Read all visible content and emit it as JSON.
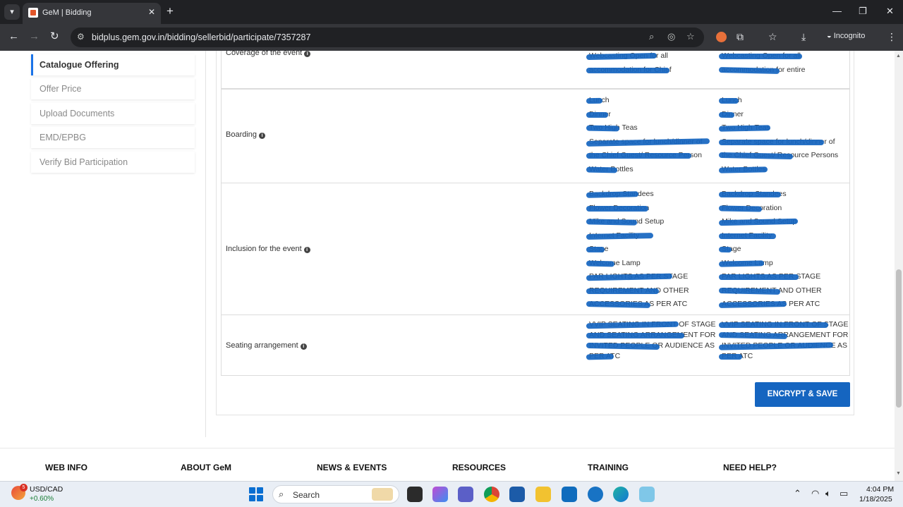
{
  "browser": {
    "tab_title": "GeM | Bidding",
    "url": "bidplus.gem.gov.in/bidding/sellerbid/participate/7357287",
    "profile_label": "Incognito"
  },
  "sidebar": {
    "items": [
      {
        "label": "Catalogue Offering",
        "active": true
      },
      {
        "label": "Offer Price",
        "active": false
      },
      {
        "label": "Upload Documents",
        "active": false
      },
      {
        "label": "EMD/EPBG",
        "active": false
      },
      {
        "label": "Verify Bid Participation",
        "active": false
      }
    ]
  },
  "table": {
    "rows": [
      {
        "label": "Coverage of the event",
        "col1": [
          "Webcasting Open for all",
          "accommodation for Chief"
        ],
        "col2": [
          "Webcasting Open for all",
          "accommodation for entire"
        ]
      },
      {
        "label": "Boarding",
        "col1": [
          "Lunch",
          "Dinner",
          "Two High Teas",
          "Separate space for lunch/dinner of",
          "the Chief Guest/ Resource Person",
          "Water Bottles"
        ],
        "col2": [
          "Lunch",
          "Dinner",
          "Two High Teas",
          "Separate space for lunch/dinner of",
          "the Chief Guest/ Resource Persons",
          "Water Bottles"
        ]
      },
      {
        "label": "Inclusion for the event",
        "col1": [
          "Backdrop Standees",
          "Flower Decoration",
          "Mike and Sound Setup",
          "Internet Facility",
          "Stage",
          "Welcome Lamp",
          "PAR LIGHTS AS PER STAGE",
          "REQUIREMENT AND OTHER",
          "ACCESSORIES AS PER ATC"
        ],
        "col2": [
          "Backdrop Standees",
          "Flower Decoration",
          "Mike and Sound Setup",
          "Internet Facility",
          "Stage",
          "Welcome Lamp",
          "PAR LIGHTS AS PER STAGE",
          "REQUIREMENT AND OTHER",
          "ACCESSORIES AS PER ATC"
        ]
      },
      {
        "label": "Seating arrangement",
        "col1": [
          "VVIP SEATING IN FRONT OF STAGE",
          "AND SEATING ARRANGEMENT FOR",
          "INVITED PEOPLE OR AUDIENCE AS",
          "PER ATC"
        ],
        "col2": [
          "VVIP SEATING IN FRONT OF STAGE",
          "AND SEATING ARRANGEMENT FOR",
          "INVITED PEOPLE OR AUDIENCE AS",
          "PER ATC"
        ]
      }
    ]
  },
  "actions": {
    "encrypt_save_label": "ENCRYPT & SAVE"
  },
  "footer": {
    "links": [
      "WEB INFO",
      "ABOUT GeM",
      "NEWS & EVENTS",
      "RESOURCES",
      "TRAINING",
      "NEED HELP?"
    ]
  },
  "taskbar": {
    "weather_badge": "5",
    "ticker_name": "USD/CAD",
    "ticker_change": "+0.60%",
    "search_label": "Search",
    "time": "4:04 PM",
    "date": "1/18/2025"
  },
  "colors": {
    "accent_blue": "#1565c0",
    "active_indicator": "#1a73e8",
    "chrome_dark": "#202124",
    "chrome_toolbar": "#35363a"
  }
}
